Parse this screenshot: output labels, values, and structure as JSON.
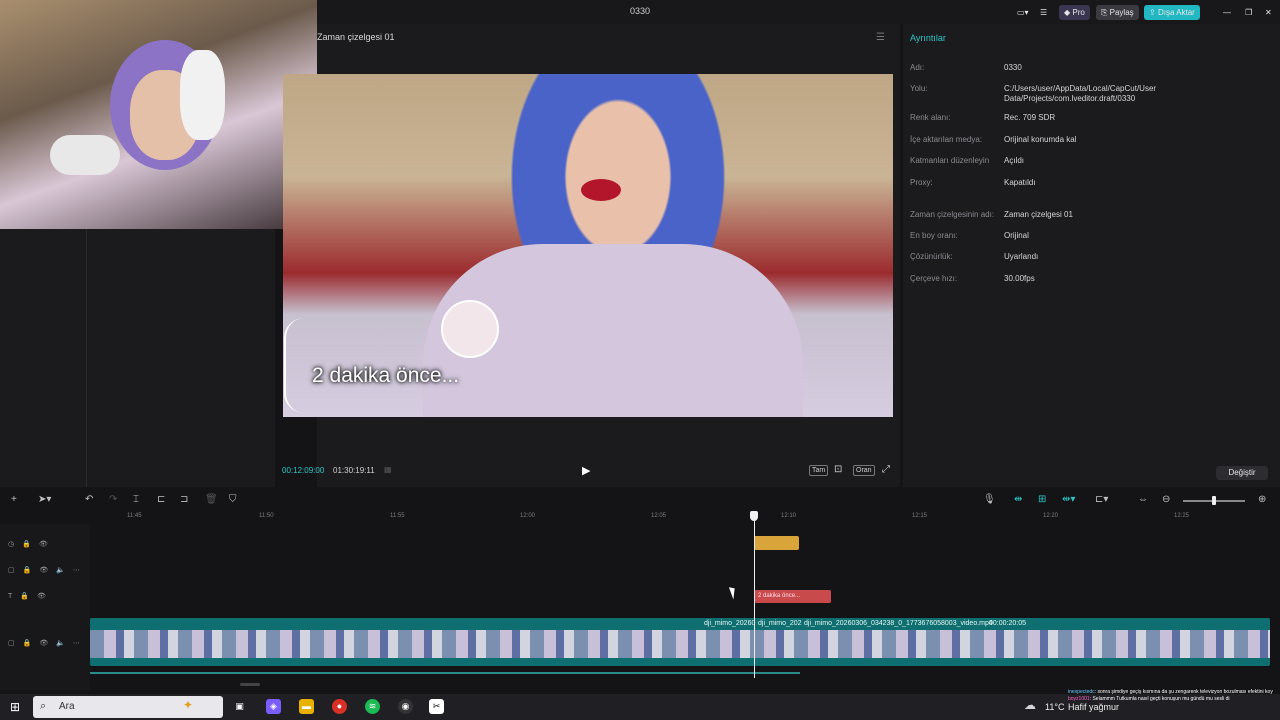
{
  "window": {
    "title": "0330",
    "pro_label": "Pro",
    "share_label": "Paylaş",
    "export_label": "Dışa Aktar"
  },
  "player": {
    "title": "Zaman çizelgesi 01",
    "caption": "2 dakika önce...",
    "current_time": "00:12:09:00",
    "total_time": "01:30:19:11",
    "btn_full": "Tam",
    "btn_ratio": "Oran"
  },
  "details": {
    "title": "Ayrıntılar",
    "rows": [
      {
        "label": "Adı:",
        "value": "0330"
      },
      {
        "label": "Yolu:",
        "value": "C:/Users/user/AppData/Local/CapCut/User Data/Projects/com.lveditor.draft/0330"
      },
      {
        "label": "Renk alanı:",
        "value": "Rec. 709 SDR"
      },
      {
        "label": "İçe aktarılan medya:",
        "value": "Orijinal konumda kal"
      },
      {
        "label": "Katmanları düzenleyin",
        "value": "Açıldı"
      },
      {
        "label": "Proxy:",
        "value": "Kapatıldı"
      },
      {
        "label": "Zaman çizelgesinin adı:",
        "value": "Zaman çizelgesi 01"
      },
      {
        "label": "En boy oranı:",
        "value": "Orijinal"
      },
      {
        "label": "Çözünürlük:",
        "value": "Uyarlandı"
      },
      {
        "label": "Çerçeve hızı:",
        "value": "30.00fps"
      }
    ],
    "change_label": "Değiştir"
  },
  "timeline": {
    "ticks": [
      "11:45",
      "11:50",
      "11:55",
      "12:00",
      "12:05",
      "12:10",
      "12:15",
      "12:20",
      "12:25"
    ],
    "text_clip": "2 dakika önce...",
    "clip_a": "dji_mimo_20260",
    "clip_b": "dji_mimo_202",
    "clip_c": "dji_mimo_20260306_034238_0_1773676058003_video.mp4",
    "clip_c_duration": "00:00:20:05"
  },
  "taskbar": {
    "search_placeholder": "Ara",
    "weather": "11°C",
    "weather_desc": "Hafif yağmur",
    "chat_line1_user": "inexpectedc",
    "chat_line1": ": sonra şimdiye geçiş kısmına da şu zengarenk televizyon bozulması efektini koy",
    "chat_line2_user": "boyz1001",
    "chat_line2": ": Selammm Tutkumla nasıl geçti konuşun mu gündü mu sesli di"
  }
}
